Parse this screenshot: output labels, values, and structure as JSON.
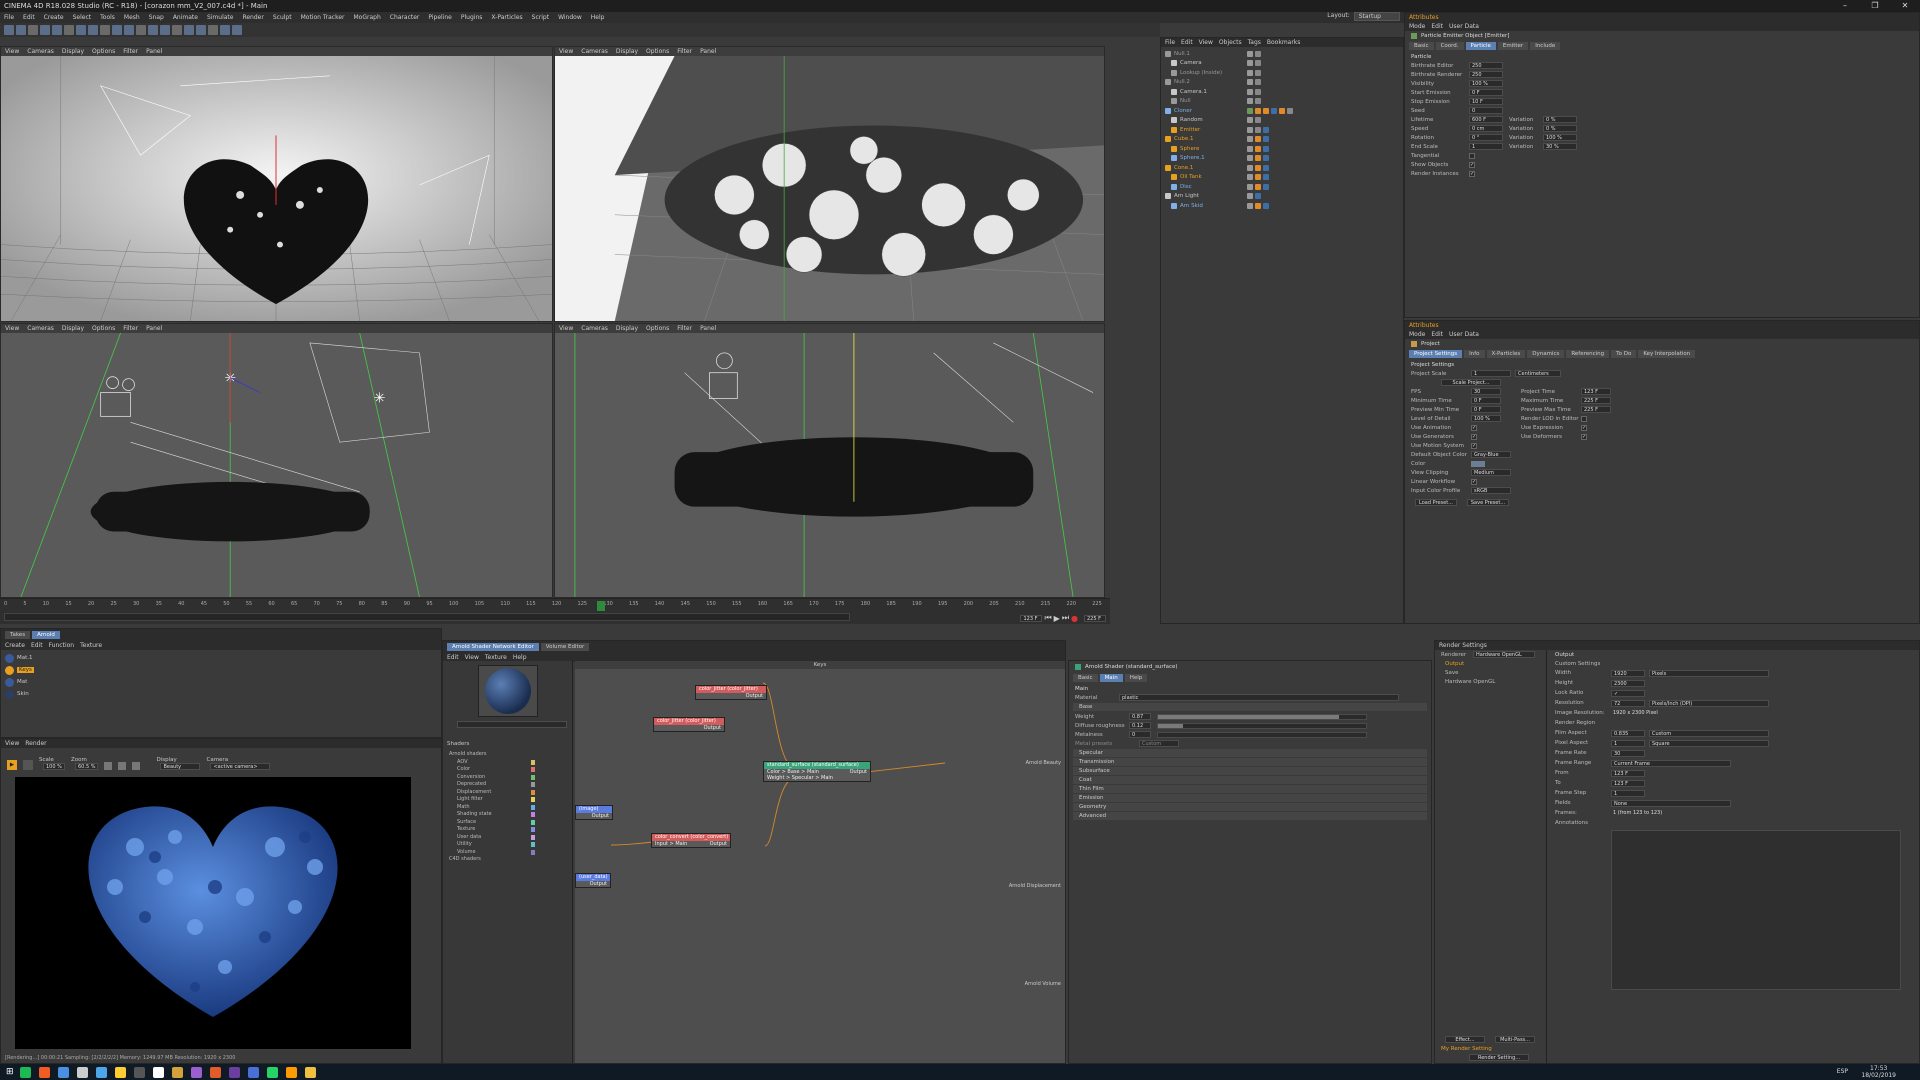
{
  "titlebar": {
    "title": "CINEMA 4D R18.028 Studio (RC - R18) - [corazon mm_V2_007.c4d *] - Main"
  },
  "menubar": {
    "items": [
      "File",
      "Edit",
      "Create",
      "Select",
      "Tools",
      "Mesh",
      "Snap",
      "Animate",
      "Simulate",
      "Render",
      "Sculpt",
      "Motion Tracker",
      "MoGraph",
      "Character",
      "Pipeline",
      "Plugins",
      "X-Particles",
      "Script",
      "Window",
      "Help"
    ],
    "layout_label": "Layout:",
    "layout_value": "Startup"
  },
  "viewports": {
    "menu": [
      "View",
      "Cameras",
      "Display",
      "Options",
      "Filter",
      "Panel"
    ]
  },
  "timeline": {
    "ticks": [
      "0",
      "5",
      "10",
      "15",
      "20",
      "25",
      "30",
      "35",
      "40",
      "45",
      "50",
      "55",
      "60",
      "65",
      "70",
      "75",
      "80",
      "85",
      "90",
      "95",
      "100",
      "105",
      "110",
      "115",
      "120",
      "125",
      "130",
      "135",
      "140",
      "145",
      "150",
      "155",
      "160",
      "165",
      "170",
      "175",
      "180",
      "185",
      "190",
      "195",
      "200",
      "205",
      "210",
      "215",
      "220",
      "225"
    ],
    "current_frame": "123 F",
    "start": "0 F",
    "end": "225 F"
  },
  "object_manager": {
    "menu": [
      "File",
      "Edit",
      "View",
      "Objects",
      "Tags",
      "Bookmarks"
    ],
    "objects": [
      {
        "name": "Null.1",
        "color": "#999"
      },
      {
        "name": "Camera",
        "color": "#c8c8c8"
      },
      {
        "name": "Lookup (Inside)",
        "color": "#999"
      },
      {
        "name": "Null.2",
        "color": "#999"
      },
      {
        "name": "Camera.1",
        "color": "#c8c8c8"
      },
      {
        "name": "Null",
        "color": "#999"
      },
      {
        "name": "Cloner",
        "color": "#7fb0e8"
      },
      {
        "name": "Random",
        "color": "#c8c8c8"
      },
      {
        "name": "Emitter",
        "color": "#e8a020"
      },
      {
        "name": "Cube.1",
        "color": "#e8a020"
      },
      {
        "name": "Sphere",
        "color": "#e8a020"
      },
      {
        "name": "Sphere.1",
        "color": "#7fb0e8"
      },
      {
        "name": "Cone.1",
        "color": "#e8a020"
      },
      {
        "name": "Oil Tank",
        "color": "#e8a020"
      },
      {
        "name": "Disc",
        "color": "#7fb0e8"
      },
      {
        "name": "Arn Light",
        "color": "#c8c8c8"
      },
      {
        "name": "Arn Skid",
        "color": "#7fb0e8"
      }
    ]
  },
  "attributes_top": {
    "title": "Attributes",
    "menu": [
      "Mode",
      "Edit",
      "User Data"
    ],
    "object_label": "Particle Emitter Object [Emitter]",
    "tabs": [
      "Basic",
      "Coord.",
      "Particle",
      "Emitter",
      "Include"
    ],
    "active_tab": "Particle",
    "section": "Particle",
    "rows": [
      {
        "label": "Birthrate Editor",
        "value": "250"
      },
      {
        "label": "Birthrate Renderer",
        "value": "250"
      },
      {
        "label": "Visibility",
        "value": "100 %"
      },
      {
        "label": "Start Emission",
        "value": "0 F"
      },
      {
        "label": "Stop Emission",
        "value": "10 F"
      },
      {
        "label": "Seed",
        "value": "0"
      },
      {
        "label": "Lifetime",
        "value": "600 F",
        "var_label": "Variation",
        "var": "0 %"
      },
      {
        "label": "Speed",
        "value": "0 cm",
        "var_label": "Variation",
        "var": "0 %"
      },
      {
        "label": "Rotation",
        "value": "0 °",
        "var_label": "Variation",
        "var": "100 %"
      },
      {
        "label": "End Scale",
        "value": "1",
        "var_label": "Variation",
        "var": "30 %"
      }
    ],
    "checks": [
      {
        "label": "Tangential",
        "checked": ""
      },
      {
        "label": "Show Objects",
        "checked": "✓"
      },
      {
        "label": "Render Instances",
        "checked": "✓"
      }
    ]
  },
  "attributes_bottom": {
    "title": "Attributes",
    "menu": [
      "Mode",
      "Edit",
      "User Data"
    ],
    "object_label": "Project",
    "tabs": [
      "Project Settings",
      "Info",
      "X-Particles",
      "Dynamics",
      "Referencing",
      "To Do",
      "Key Interpolation"
    ],
    "active_tab": "Project Settings",
    "section": "Project Settings",
    "project_scale_label": "Project Scale",
    "project_scale_value": "1",
    "project_scale_unit": "Centimeters",
    "scale_btn": "Scale Project...",
    "left_rows": [
      {
        "label": "FPS",
        "value": "30"
      },
      {
        "label": "Minimum Time",
        "value": "0 F"
      },
      {
        "label": "Preview Min Time",
        "value": "0 F"
      },
      {
        "label": "Level of Detail",
        "value": "100 %"
      }
    ],
    "right_rows": [
      {
        "label": "Project Time",
        "value": "123 F"
      },
      {
        "label": "Maximum Time",
        "value": "225 F"
      },
      {
        "label": "Preview Max Time",
        "value": "225 F"
      },
      {
        "label": "Render LOD in Editor",
        "value": ""
      }
    ],
    "check_left": [
      "Use Animation",
      "Use Generators",
      "Use Motion System"
    ],
    "check_right": [
      "Use Expression",
      "Use Deformers"
    ],
    "default_color_label": "Default Object Color",
    "default_color_value": "Gray-Blue",
    "color_label": "Color",
    "clipping_label": "View Clipping",
    "clipping_value": "Medium",
    "linear_label": "Linear Workflow",
    "input_color_label": "Input Color Profile",
    "input_color_value": "sRGB",
    "load_btn": "Load Preset...",
    "save_btn": "Save Preset..."
  },
  "material_manager": {
    "tabs": [
      "Takes",
      "Arnold"
    ],
    "menu": [
      "Create",
      "Edit",
      "Function",
      "Texture"
    ],
    "materials": [
      {
        "name": "Mat.1",
        "color": "#3a5a9a"
      },
      {
        "name": "Keys",
        "color": "#e8a020"
      },
      {
        "name": "Mat",
        "color": "#3a5a9a"
      },
      {
        "name": "Skin",
        "color": "#2c3e66"
      }
    ]
  },
  "ipr": {
    "menu": [
      "View",
      "Render"
    ],
    "scale_label": "Scale",
    "scale_value": "100 %",
    "zoom_label": "Zoom",
    "zoom_value": "60.5 %",
    "display_label": "Display",
    "display_value": "Beauty",
    "camera_label": "Camera",
    "camera_value": "<active camera>",
    "status": "[Rendering...] 00:00:21  Sampling: [2/2/2/2/2]  Memory: 1249.97 MB  Resolution: 1920 x 2300"
  },
  "shader_editor": {
    "tabs": [
      "Arnold Shader Network Editor",
      "Volume Editor"
    ],
    "menu": [
      "Edit",
      "View",
      "Texture",
      "Help"
    ],
    "title": "Keys",
    "shaders_title": "Shaders",
    "shader_groups": [
      {
        "name": "Arnold shaders",
        "color": ""
      },
      {
        "name": "AOV",
        "color": "#d8c060"
      },
      {
        "name": "Color",
        "color": "#e07070"
      },
      {
        "name": "Conversion",
        "color": "#70c070"
      },
      {
        "name": "Deprecated",
        "color": "#999999"
      },
      {
        "name": "Displacement",
        "color": "#d89040"
      },
      {
        "name": "Light filter",
        "color": "#e8d060"
      },
      {
        "name": "Math",
        "color": "#60b0e0"
      },
      {
        "name": "Shading state",
        "color": "#c080e0"
      },
      {
        "name": "Surface",
        "color": "#60d0a0"
      },
      {
        "name": "Texture",
        "color": "#8090e0"
      },
      {
        "name": "User data",
        "color": "#c0a0e0"
      },
      {
        "name": "Utility",
        "color": "#60c0c0"
      },
      {
        "name": "Volume",
        "color": "#8080c0"
      },
      {
        "name": "C4D shaders",
        "color": ""
      }
    ],
    "nodes": {
      "color_jitter": {
        "title": "color_jitter (color_jitter)",
        "port": "Output"
      },
      "color_jitter2": {
        "title": "color_jitter (color_jitter)",
        "port": "Output"
      },
      "standard_surface": {
        "title": "standard_surface (standard_surface)",
        "in1": "Color > Base > Main",
        "in2": "Weight > Specular > Main",
        "port": "Output"
      },
      "color_convert": {
        "title": "color_convert (color_convert)",
        "in1": "Input > Main",
        "port": "Output"
      },
      "image": {
        "title": "(image)",
        "port": "Output"
      },
      "user_data": {
        "title": "(user_data)",
        "port": "Output"
      },
      "beauty_label": "Arnold Beauty",
      "disp_label": "Arnold Displacement",
      "volume_label": "Arnold Volume"
    }
  },
  "shader_attr": {
    "title": "Arnold Shader (standard_surface)",
    "tabs": [
      "Basic",
      "Main",
      "Help"
    ],
    "active_tab": "Main",
    "main_label": "Main",
    "material_label": "Material",
    "material_value": "plastic",
    "base_section": "Base",
    "rows": [
      {
        "label": "Weight",
        "value": "0.87",
        "fill": 0.87
      },
      {
        "label": "Diffuse roughness",
        "value": "0.12",
        "fill": 0.12
      },
      {
        "label": "Metalness",
        "value": "0",
        "fill": 0
      }
    ],
    "metal_preset_label": "Metal presets",
    "metal_preset_value": "Custom",
    "sections": [
      "Specular",
      "Transmission",
      "Subsurface",
      "Coat",
      "Thin Film",
      "Emission",
      "Geometry",
      "Advanced"
    ]
  },
  "render_settings": {
    "title": "Render Settings",
    "renderer_label": "Renderer",
    "renderer_value": "Hardware OpenGL",
    "list": [
      {
        "name": "Output",
        "color": "#e8a020"
      },
      {
        "name": "Save",
        "color": "#bbb"
      },
      {
        "name": "Hardware OpenGL",
        "color": "#bbb"
      }
    ],
    "output_title": "Output",
    "preset_label": "Custom Settings",
    "rows": [
      {
        "label": "Width",
        "value": "1920",
        "unit": "Pixels"
      },
      {
        "label": "Height",
        "value": "2300",
        "unit": ""
      },
      {
        "label": "Lock Ratio",
        "value": "✓",
        "unit": ""
      },
      {
        "label": "Resolution",
        "value": "72",
        "unit": "Pixels/Inch (DPI)"
      },
      {
        "label": "Image Resolution:",
        "value": "1920 x 2300 Pixel",
        "unit": ""
      },
      {
        "label": "Render Region",
        "value": "",
        "unit": ""
      },
      {
        "label": "Film Aspect",
        "value": "0.835",
        "unit": "Custom"
      },
      {
        "label": "Pixel Aspect",
        "value": "1",
        "unit": "Square"
      },
      {
        "label": "Frame Rate",
        "value": "30",
        "unit": ""
      },
      {
        "label": "Frame Range",
        "value": "",
        "unit": "Current Frame"
      },
      {
        "label": "From",
        "value": "123 F",
        "unit": ""
      },
      {
        "label": "To",
        "value": "123 F",
        "unit": ""
      },
      {
        "label": "Frame Step",
        "value": "1",
        "unit": ""
      },
      {
        "label": "Fields",
        "value": "",
        "unit": "None"
      },
      {
        "label": "Frames:",
        "value": "1 (from 123 to 123)",
        "unit": ""
      },
      {
        "label": "Annotations",
        "value": "",
        "unit": ""
      }
    ],
    "effect_btn": "Effect...",
    "multipass_btn": "Multi-Pass...",
    "setting_name": "My Render Setting",
    "render_btn": "Render Setting..."
  },
  "taskbar": {
    "time": "17:53",
    "date": "18/02/2019",
    "lang": "ESP",
    "icons": [
      "#1db954",
      "#f35b22",
      "#4a90e2",
      "#cccccc",
      "#4ea6ea",
      "#ffcc33",
      "#555555",
      "#ffffff",
      "#d4a13a",
      "#9c5fcf",
      "#e45b2a",
      "#6b3fa0",
      "#4a6fd6",
      "#25d366",
      "#ff9a00",
      "#f0c040"
    ]
  }
}
